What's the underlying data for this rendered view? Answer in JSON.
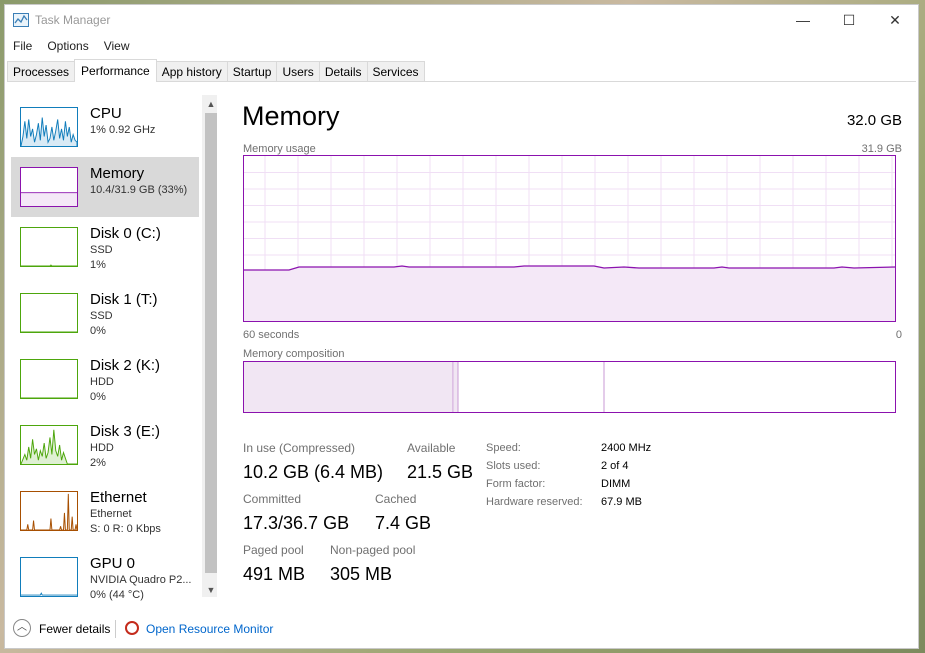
{
  "window": {
    "title": "Task Manager",
    "controls": {
      "minimize": "—",
      "maximize": "☐",
      "close": "✕"
    }
  },
  "menu": [
    "File",
    "Options",
    "View"
  ],
  "tabs": [
    "Processes",
    "Performance",
    "App history",
    "Startup",
    "Users",
    "Details",
    "Services"
  ],
  "active_tab": "Performance",
  "sidebar": {
    "items": [
      {
        "name": "CPU",
        "sub1": "1%  0.92 GHz",
        "sub2": "",
        "color": "#117dbb"
      },
      {
        "name": "Memory",
        "sub1": "10.4/31.9 GB (33%)",
        "sub2": "",
        "color": "#8b12ae"
      },
      {
        "name": "Disk 0 (C:)",
        "sub1": "SSD",
        "sub2": "1%",
        "color": "#4da60c"
      },
      {
        "name": "Disk 1 (T:)",
        "sub1": "SSD",
        "sub2": "0%",
        "color": "#4da60c"
      },
      {
        "name": "Disk 2 (K:)",
        "sub1": "HDD",
        "sub2": "0%",
        "color": "#4da60c"
      },
      {
        "name": "Disk 3 (E:)",
        "sub1": "HDD",
        "sub2": "2%",
        "color": "#4da60c"
      },
      {
        "name": "Ethernet",
        "sub1": "Ethernet",
        "sub2": "S: 0  R: 0 Kbps",
        "color": "#a74f01"
      },
      {
        "name": "GPU 0",
        "sub1": "NVIDIA Quadro P2...",
        "sub2": "0%  (44 °C)",
        "color": "#117dbb"
      }
    ]
  },
  "main": {
    "title": "Memory",
    "total": "32.0 GB",
    "usage_label": "Memory usage",
    "usage_max": "31.9 GB",
    "time_left": "60 seconds",
    "time_right": "0",
    "composition_label": "Memory composition",
    "stats": {
      "in_use_label": "In use (Compressed)",
      "in_use_value": "10.2 GB (6.4 MB)",
      "available_label": "Available",
      "available_value": "21.5 GB",
      "committed_label": "Committed",
      "committed_value": "17.3/36.7 GB",
      "cached_label": "Cached",
      "cached_value": "7.4 GB",
      "paged_label": "Paged pool",
      "paged_value": "491 MB",
      "nonpaged_label": "Non-paged pool",
      "nonpaged_value": "305 MB"
    },
    "details": {
      "speed_label": "Speed:",
      "speed_value": "2400 MHz",
      "slots_label": "Slots used:",
      "slots_value": "2 of 4",
      "form_label": "Form factor:",
      "form_value": "DIMM",
      "reserved_label": "Hardware reserved:",
      "reserved_value": "67.9 MB"
    }
  },
  "footer": {
    "fewer_details": "Fewer details",
    "open_resource_monitor": "Open Resource Monitor"
  }
}
